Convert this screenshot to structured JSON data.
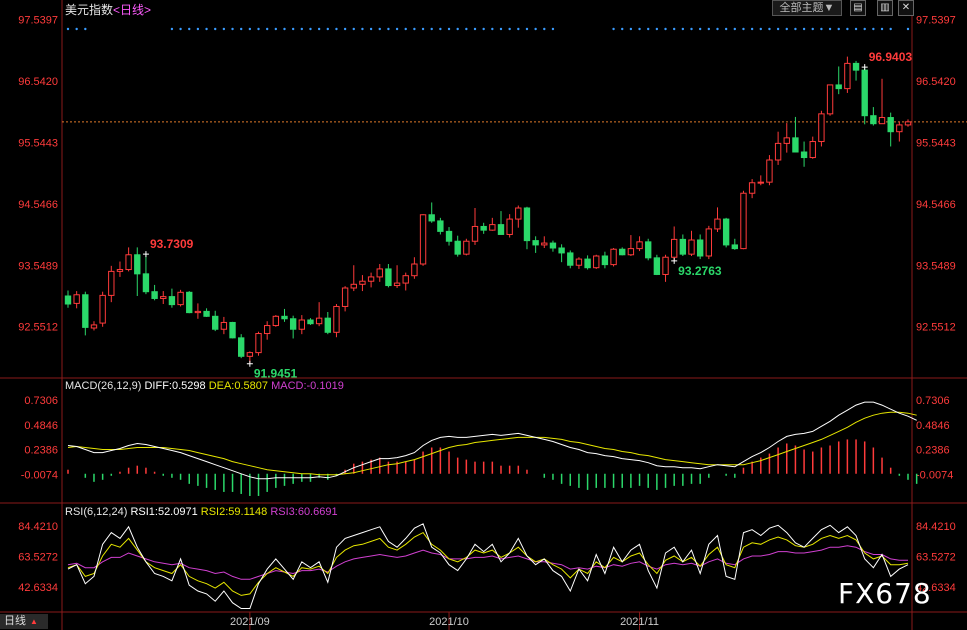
{
  "header": {
    "symbol": "美元指数",
    "period": "<日线>",
    "theme_button": "全部主题▼",
    "icons": [
      "chart-toggle-icon",
      "layout-icon",
      "close-icon"
    ]
  },
  "footer": {
    "period_tab": "日线",
    "watermark": "FX678"
  },
  "macd_header": {
    "name": "MACD(26,12,9)",
    "diff": "DIFF:0.5298",
    "dea": "DEA:0.5807",
    "macd": "MACD:-0.1019"
  },
  "rsi_header": {
    "name": "RSI(6,12,24)",
    "rsi1": "RSI1:52.0971",
    "rsi2": "RSI2:59.1148",
    "rsi3": "RSI3:60.6691"
  },
  "colors": {
    "up": "#ff3b3b",
    "down": "#2bd86a",
    "axis": "#c23030",
    "diff": "#ffffff",
    "dea": "#e6e600",
    "rsi3": "#d040d0",
    "refline": "#e07a2a"
  },
  "chart_data": {
    "type": "candlestick",
    "price_axis_ticks": [
      "97.5397",
      "96.5420",
      "95.5443",
      "94.5466",
      "93.5489",
      "92.5512"
    ],
    "price_range": [
      91.75,
      97.6
    ],
    "x_axis_labels": [
      "2021/09",
      "2021/10",
      "2021/11"
    ],
    "annotations": [
      {
        "text": "93.7309",
        "candle": 9
      },
      {
        "text": "91.9451",
        "candle": 21
      },
      {
        "text": "93.2763",
        "candle": 70
      },
      {
        "text": "96.9403",
        "candle": 92
      }
    ],
    "ohlc": [
      [
        93.05,
        93.14,
        92.86,
        92.92
      ],
      [
        92.93,
        93.13,
        92.85,
        93.07
      ],
      [
        93.07,
        93.12,
        92.41,
        92.54
      ],
      [
        92.53,
        92.64,
        92.49,
        92.58
      ],
      [
        92.61,
        93.12,
        92.55,
        93.06
      ],
      [
        93.06,
        93.54,
        92.95,
        93.45
      ],
      [
        93.45,
        93.61,
        93.36,
        93.48
      ],
      [
        93.48,
        93.84,
        93.45,
        93.72
      ],
      [
        93.72,
        93.84,
        93.05,
        93.41
      ],
      [
        93.41,
        93.73,
        93.08,
        93.12
      ],
      [
        93.12,
        93.23,
        92.98,
        93.01
      ],
      [
        93.01,
        93.13,
        92.92,
        93.04
      ],
      [
        93.04,
        93.17,
        92.86,
        92.91
      ],
      [
        92.91,
        93.15,
        92.88,
        93.11
      ],
      [
        93.11,
        93.13,
        92.77,
        92.78
      ],
      [
        92.78,
        92.93,
        92.68,
        92.8
      ],
      [
        92.8,
        92.85,
        92.71,
        92.72
      ],
      [
        92.72,
        92.81,
        92.48,
        92.51
      ],
      [
        92.51,
        92.71,
        92.43,
        92.62
      ],
      [
        92.62,
        92.63,
        92.36,
        92.37
      ],
      [
        92.37,
        92.43,
        92.04,
        92.07
      ],
      [
        92.07,
        92.15,
        91.95,
        92.13
      ],
      [
        92.13,
        92.47,
        92.08,
        92.44
      ],
      [
        92.44,
        92.64,
        92.34,
        92.57
      ],
      [
        92.57,
        92.74,
        92.55,
        92.72
      ],
      [
        92.72,
        92.84,
        92.63,
        92.68
      ],
      [
        92.68,
        92.73,
        92.36,
        92.51
      ],
      [
        92.51,
        92.74,
        92.43,
        92.66
      ],
      [
        92.66,
        92.69,
        92.58,
        92.6
      ],
      [
        92.6,
        92.95,
        92.56,
        92.69
      ],
      [
        92.69,
        92.79,
        92.43,
        92.46
      ],
      [
        92.46,
        92.92,
        92.38,
        92.88
      ],
      [
        92.88,
        93.21,
        92.8,
        93.18
      ],
      [
        93.18,
        93.55,
        93.13,
        93.24
      ],
      [
        93.24,
        93.39,
        93.13,
        93.29
      ],
      [
        93.29,
        93.43,
        93.19,
        93.36
      ],
      [
        93.36,
        93.57,
        93.28,
        93.49
      ],
      [
        93.49,
        93.57,
        93.19,
        93.22
      ],
      [
        93.22,
        93.55,
        93.18,
        93.26
      ],
      [
        93.26,
        93.43,
        93.14,
        93.38
      ],
      [
        93.38,
        93.68,
        93.33,
        93.57
      ],
      [
        93.57,
        94.38,
        93.54,
        94.37
      ],
      [
        94.37,
        94.57,
        94.24,
        94.27
      ],
      [
        94.27,
        94.32,
        94.05,
        94.1
      ],
      [
        94.1,
        94.17,
        93.87,
        93.94
      ],
      [
        93.94,
        94.03,
        93.69,
        93.73
      ],
      [
        93.73,
        93.98,
        93.71,
        93.94
      ],
      [
        93.94,
        94.48,
        93.88,
        94.18
      ],
      [
        94.18,
        94.24,
        94.06,
        94.12
      ],
      [
        94.12,
        94.32,
        94.11,
        94.21
      ],
      [
        94.21,
        94.43,
        94.14,
        94.05
      ],
      [
        94.05,
        94.38,
        94.0,
        94.3
      ],
      [
        94.3,
        94.52,
        94.16,
        94.48
      ],
      [
        94.48,
        94.5,
        93.81,
        93.95
      ],
      [
        93.95,
        94.02,
        93.75,
        93.88
      ],
      [
        93.88,
        94.02,
        93.83,
        93.91
      ],
      [
        93.91,
        93.95,
        93.77,
        93.83
      ],
      [
        93.83,
        93.89,
        93.6,
        93.75
      ],
      [
        93.75,
        93.79,
        93.5,
        93.55
      ],
      [
        93.55,
        93.68,
        93.49,
        93.65
      ],
      [
        93.65,
        93.71,
        93.48,
        93.51
      ],
      [
        93.51,
        93.72,
        93.49,
        93.7
      ],
      [
        93.7,
        93.77,
        93.5,
        93.56
      ],
      [
        93.56,
        93.83,
        93.53,
        93.81
      ],
      [
        93.81,
        93.84,
        93.71,
        93.72
      ],
      [
        93.72,
        94.04,
        93.7,
        93.82
      ],
      [
        93.82,
        94.02,
        93.78,
        93.93
      ],
      [
        93.93,
        93.98,
        93.63,
        93.67
      ],
      [
        93.67,
        93.72,
        93.39,
        93.4
      ],
      [
        93.4,
        93.72,
        93.28,
        93.68
      ],
      [
        93.68,
        94.18,
        93.62,
        93.97
      ],
      [
        93.97,
        94.05,
        93.7,
        93.73
      ],
      [
        93.73,
        94.11,
        93.7,
        93.96
      ],
      [
        93.96,
        94.05,
        93.65,
        93.7
      ],
      [
        93.7,
        94.19,
        93.65,
        94.14
      ],
      [
        94.14,
        94.49,
        94.09,
        94.3
      ],
      [
        94.3,
        94.32,
        93.84,
        93.88
      ],
      [
        93.88,
        93.98,
        93.8,
        93.82
      ],
      [
        93.82,
        94.76,
        93.81,
        94.72
      ],
      [
        94.72,
        94.95,
        94.64,
        94.89
      ],
      [
        94.89,
        95.01,
        94.85,
        94.9
      ],
      [
        94.9,
        95.34,
        94.85,
        95.26
      ],
      [
        95.26,
        95.72,
        95.18,
        95.53
      ],
      [
        95.53,
        95.86,
        95.38,
        95.62
      ],
      [
        95.62,
        95.96,
        95.58,
        95.39
      ],
      [
        95.39,
        95.56,
        95.15,
        95.3
      ],
      [
        95.3,
        95.64,
        95.28,
        95.56
      ],
      [
        95.56,
        96.06,
        95.48,
        96.01
      ],
      [
        96.01,
        96.42,
        95.98,
        96.48
      ],
      [
        96.48,
        96.78,
        96.33,
        96.42
      ],
      [
        96.42,
        96.94,
        96.35,
        96.83
      ],
      [
        96.83,
        96.87,
        96.55,
        96.72
      ],
      [
        96.72,
        96.77,
        95.84,
        95.98
      ],
      [
        95.98,
        96.12,
        95.82,
        95.85
      ],
      [
        95.85,
        96.58,
        95.85,
        95.95
      ],
      [
        95.95,
        96.03,
        95.48,
        95.72
      ],
      [
        95.72,
        95.88,
        95.56,
        95.83
      ],
      [
        95.83,
        95.92,
        95.8,
        95.88
      ]
    ],
    "reference_line": 95.88,
    "macd": {
      "axis_ticks": [
        "0.7306",
        "0.4846",
        "0.2386",
        "-0.0074"
      ],
      "range": [
        -0.26,
        0.8
      ],
      "diff": [
        0.28,
        0.27,
        0.24,
        0.21,
        0.21,
        0.23,
        0.25,
        0.28,
        0.3,
        0.29,
        0.27,
        0.25,
        0.23,
        0.21,
        0.18,
        0.15,
        0.12,
        0.09,
        0.06,
        0.03,
        0.0,
        -0.03,
        -0.05,
        -0.05,
        -0.04,
        -0.04,
        -0.04,
        -0.04,
        -0.04,
        -0.03,
        -0.04,
        -0.02,
        0.02,
        0.06,
        0.09,
        0.12,
        0.15,
        0.15,
        0.16,
        0.18,
        0.21,
        0.28,
        0.33,
        0.36,
        0.37,
        0.36,
        0.36,
        0.37,
        0.38,
        0.39,
        0.38,
        0.39,
        0.4,
        0.38,
        0.36,
        0.34,
        0.32,
        0.29,
        0.26,
        0.24,
        0.21,
        0.2,
        0.18,
        0.17,
        0.15,
        0.14,
        0.13,
        0.11,
        0.08,
        0.07,
        0.07,
        0.06,
        0.06,
        0.05,
        0.07,
        0.09,
        0.08,
        0.07,
        0.12,
        0.17,
        0.21,
        0.26,
        0.32,
        0.37,
        0.39,
        0.4,
        0.42,
        0.47,
        0.52,
        0.58,
        0.63,
        0.68,
        0.71,
        0.71,
        0.68,
        0.64,
        0.6,
        0.57,
        0.53
      ],
      "dea": [
        0.26,
        0.27,
        0.26,
        0.25,
        0.24,
        0.24,
        0.24,
        0.25,
        0.26,
        0.26,
        0.26,
        0.26,
        0.25,
        0.24,
        0.23,
        0.21,
        0.19,
        0.17,
        0.15,
        0.12,
        0.1,
        0.08,
        0.06,
        0.04,
        0.03,
        0.02,
        0.01,
        0.0,
        0.0,
        -0.01,
        -0.01,
        -0.01,
        0.0,
        0.01,
        0.03,
        0.05,
        0.07,
        0.09,
        0.1,
        0.12,
        0.14,
        0.17,
        0.2,
        0.23,
        0.26,
        0.28,
        0.29,
        0.31,
        0.32,
        0.33,
        0.34,
        0.35,
        0.36,
        0.36,
        0.36,
        0.36,
        0.35,
        0.34,
        0.32,
        0.31,
        0.29,
        0.27,
        0.25,
        0.24,
        0.22,
        0.21,
        0.19,
        0.18,
        0.16,
        0.14,
        0.13,
        0.12,
        0.11,
        0.1,
        0.09,
        0.09,
        0.09,
        0.09,
        0.09,
        0.11,
        0.13,
        0.16,
        0.19,
        0.22,
        0.25,
        0.28,
        0.31,
        0.34,
        0.38,
        0.42,
        0.46,
        0.51,
        0.55,
        0.58,
        0.6,
        0.61,
        0.61,
        0.6,
        0.58
      ]
    },
    "rsi": {
      "axis_ticks": [
        "84.4210",
        "63.5272",
        "42.6334"
      ],
      "range": [
        27,
        90
      ],
      "rsi1": [
        55,
        58,
        45,
        50,
        72,
        80,
        76,
        84,
        70,
        60,
        52,
        50,
        47,
        62,
        44,
        40,
        38,
        33,
        40,
        32,
        28,
        28,
        45,
        55,
        62,
        55,
        48,
        60,
        56,
        60,
        46,
        70,
        76,
        78,
        80,
        82,
        84,
        74,
        70,
        76,
        83,
        86,
        70,
        66,
        58,
        54,
        62,
        72,
        67,
        72,
        60,
        66,
        76,
        64,
        58,
        62,
        54,
        50,
        40,
        55,
        47,
        65,
        52,
        70,
        60,
        68,
        72,
        54,
        42,
        66,
        70,
        60,
        68,
        52,
        72,
        78,
        50,
        48,
        80,
        82,
        78,
        83,
        85,
        80,
        73,
        70,
        76,
        82,
        85,
        80,
        84,
        78,
        62,
        56,
        65,
        50,
        55,
        58
      ],
      "rsi2": [
        56,
        58,
        50,
        52,
        64,
        72,
        70,
        76,
        68,
        60,
        56,
        54,
        52,
        58,
        50,
        47,
        45,
        42,
        46,
        40,
        37,
        38,
        46,
        52,
        56,
        53,
        50,
        56,
        55,
        57,
        52,
        63,
        68,
        71,
        72,
        74,
        76,
        70,
        68,
        72,
        77,
        80,
        72,
        68,
        62,
        60,
        63,
        68,
        66,
        68,
        63,
        66,
        70,
        64,
        60,
        62,
        58,
        55,
        49,
        55,
        52,
        60,
        56,
        63,
        60,
        64,
        66,
        58,
        52,
        61,
        64,
        60,
        63,
        57,
        65,
        70,
        58,
        56,
        70,
        73,
        72,
        75,
        77,
        75,
        71,
        70,
        72,
        76,
        78,
        76,
        78,
        75,
        66,
        62,
        64,
        58,
        58,
        59
      ],
      "rsi3": [
        58,
        59,
        56,
        56,
        60,
        63,
        63,
        66,
        64,
        62,
        60,
        59,
        58,
        59,
        56,
        55,
        54,
        52,
        53,
        50,
        48,
        48,
        50,
        52,
        54,
        53,
        52,
        54,
        54,
        55,
        53,
        57,
        60,
        62,
        63,
        64,
        65,
        64,
        63,
        64,
        66,
        68,
        66,
        65,
        62,
        62,
        62,
        63,
        63,
        64,
        62,
        63,
        64,
        62,
        60,
        60,
        59,
        58,
        55,
        56,
        55,
        57,
        56,
        58,
        57,
        59,
        60,
        57,
        55,
        58,
        59,
        58,
        59,
        57,
        60,
        62,
        59,
        58,
        62,
        64,
        64,
        65,
        67,
        67,
        66,
        66,
        67,
        68,
        70,
        70,
        71,
        70,
        67,
        65,
        65,
        62,
        61,
        61
      ]
    }
  }
}
